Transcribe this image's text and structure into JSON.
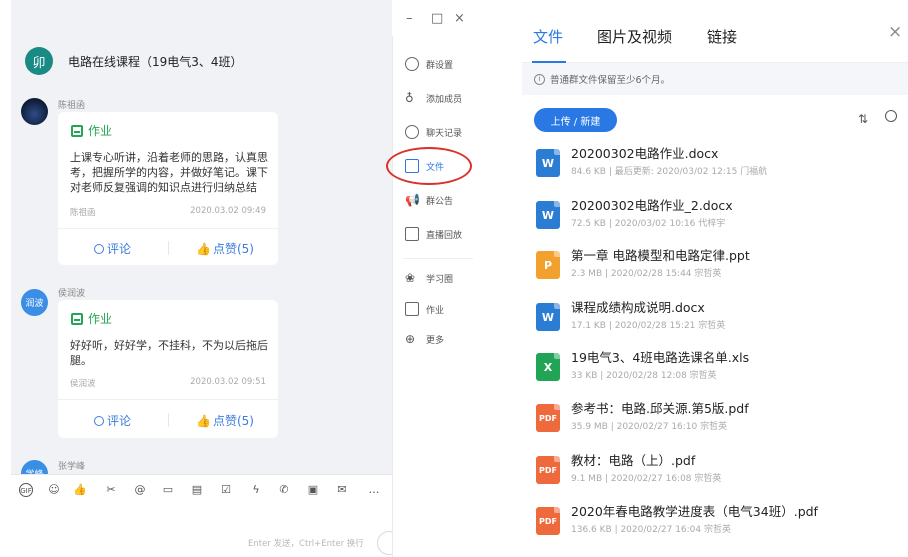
{
  "chat": {
    "group_icon": "卯",
    "title": "电路在线课程（19电气3、4班）",
    "messages": [
      {
        "sender": "陈祖函",
        "card_type": "作业",
        "body": "上课专心听讲，沿着老师的思路，认真思考，把握所学的内容，并做好笔记。课下对老师反复强调的知识点进行归纳总结",
        "author": "陈祖函",
        "time": "2020.03.02 09:49",
        "comment_label": "评论",
        "like_label": "点赞(5)"
      },
      {
        "sender": "侯润波",
        "avatar_text": "润波",
        "card_type": "作业",
        "body": "好好听，好好学，不挂科，不为以后拖后腿。",
        "author": "侯润波",
        "time": "2020.03.02 09:51",
        "comment_label": "评论",
        "like_label": "点赞(5)"
      },
      {
        "sender": "张学峰",
        "avatar_text": "学峰"
      }
    ],
    "input_hint": "Enter 发送，Ctrl+Enter 换行",
    "toolbar_icons": [
      "gif-icon",
      "emoji-icon",
      "thumbs-up-icon",
      "scissors-icon",
      "at-icon",
      "folder-icon",
      "calendar-icon",
      "checkbox-icon",
      "lightning-icon",
      "phone-icon",
      "live-icon",
      "message-icon",
      "more-icon"
    ]
  },
  "window_controls": {
    "minimize": "–",
    "maximize": "□",
    "close": "×"
  },
  "rail": {
    "items": [
      {
        "label": "群设置",
        "icon": "settings-icon"
      },
      {
        "label": "添加成员",
        "icon": "add-member-icon"
      },
      {
        "label": "聊天记录",
        "icon": "history-icon"
      },
      {
        "label": "文件",
        "icon": "folder-icon"
      },
      {
        "label": "群公告",
        "icon": "announcement-icon"
      },
      {
        "label": "直播回放",
        "icon": "replay-icon"
      },
      {
        "label": "学习圈",
        "icon": "circle-icon"
      },
      {
        "label": "作业",
        "icon": "homework-icon"
      },
      {
        "label": "更多",
        "icon": "more-icon"
      }
    ]
  },
  "panel": {
    "tabs": [
      "文件",
      "图片及视频",
      "链接"
    ],
    "active_tab": "文件",
    "close": "×",
    "notice": "普通群文件保留至少6个月。",
    "upload_label": "上传 / 新建",
    "files": [
      {
        "name": "20200302电路作业.docx",
        "meta": "84.6 KB | 最后更新: 2020/03/02 12:15 门福航",
        "type": "W",
        "color": "#2b7cd3"
      },
      {
        "name": "20200302电路作业_2.docx",
        "meta": "72.5 KB | 2020/03/02 10:16 代梓宇",
        "type": "W",
        "color": "#2b7cd3"
      },
      {
        "name": "第一章 电路模型和电路定律.ppt",
        "meta": "2.3 MB | 2020/02/28 15:44 宗哲英",
        "type": "P",
        "color": "#f2a12e"
      },
      {
        "name": "课程成绩构成说明.docx",
        "meta": "17.1 KB | 2020/02/28 15:21 宗哲英",
        "type": "W",
        "color": "#2b7cd3"
      },
      {
        "name": "19电气3、4班电路选课名单.xls",
        "meta": "33 KB | 2020/02/28 12:08 宗哲英",
        "type": "X",
        "color": "#21a456"
      },
      {
        "name": "参考书：电路.邱关源.第5版.pdf",
        "meta": "35.9 MB | 2020/02/27 16:10 宗哲英",
        "type": "PDF",
        "color": "#ee6a3c"
      },
      {
        "name": "教材：电路（上）.pdf",
        "meta": "9.1 MB | 2020/02/27 16:08 宗哲英",
        "type": "PDF",
        "color": "#ee6a3c"
      },
      {
        "name": "2020年春电路教学进度表（电气34班）.pdf",
        "meta": "136.6 KB | 2020/02/27 16:04 宗哲英",
        "type": "PDF",
        "color": "#ee6a3c"
      }
    ]
  },
  "colors": {
    "accent": "#2a78e4",
    "homework_green": "#23a553",
    "annotation_red": "#d9312b"
  }
}
